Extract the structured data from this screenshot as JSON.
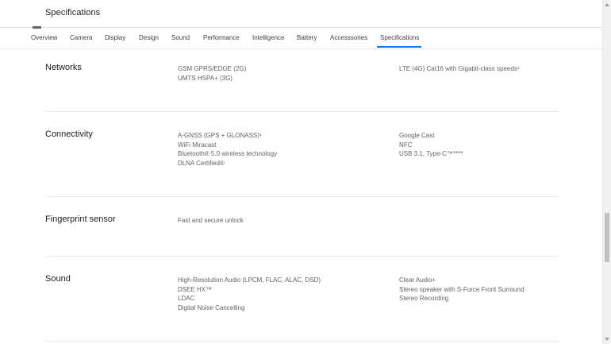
{
  "header": {
    "title": "Specifications"
  },
  "tabs": [
    {
      "label": "Overview"
    },
    {
      "label": "Camera"
    },
    {
      "label": "Display"
    },
    {
      "label": "Design"
    },
    {
      "label": "Sound"
    },
    {
      "label": "Performance"
    },
    {
      "label": "Intelligence"
    },
    {
      "label": "Battery"
    },
    {
      "label": "Accesssories"
    },
    {
      "label": "Specifications"
    }
  ],
  "active_tab": "Specifications",
  "colors": {
    "accent": "#1a73e8",
    "text_primary": "#202124",
    "text_secondary": "#5f6368",
    "divider": "#e8eaed"
  },
  "sections": [
    {
      "title": "Networks",
      "col_a": [
        "GSM GPRS/EDGE (2G)",
        "UMTS HSPA+ (3G)"
      ],
      "col_b": [
        "LTE (4G) Cat16 with Gigabit-class speeds¹"
      ]
    },
    {
      "title": "Connectivity",
      "col_a": [
        "A-GNSS (GPS + GLONASS)¹",
        "WiFi Miracast",
        "Bluetooth® 5.0 wireless technology",
        "DLNA Certified®"
      ],
      "col_b": [
        "Google Cast",
        "NFC",
        "USB 3.1, Type-C™****"
      ]
    },
    {
      "title": "Fingerprint sensor",
      "col_a": [
        "Fast and secure unlock"
      ],
      "col_b": []
    },
    {
      "title": "Sound",
      "col_a": [
        "High-Resolution Audio (LPCM, FLAC, ALAC, DSD)",
        "DSEE HX™",
        "LDAC",
        "Digital Noise Cancelling"
      ],
      "col_b": [
        "Clear Audio+",
        "Stereo speaker with S-Force Front Surround",
        "Stereo Recording"
      ]
    }
  ]
}
